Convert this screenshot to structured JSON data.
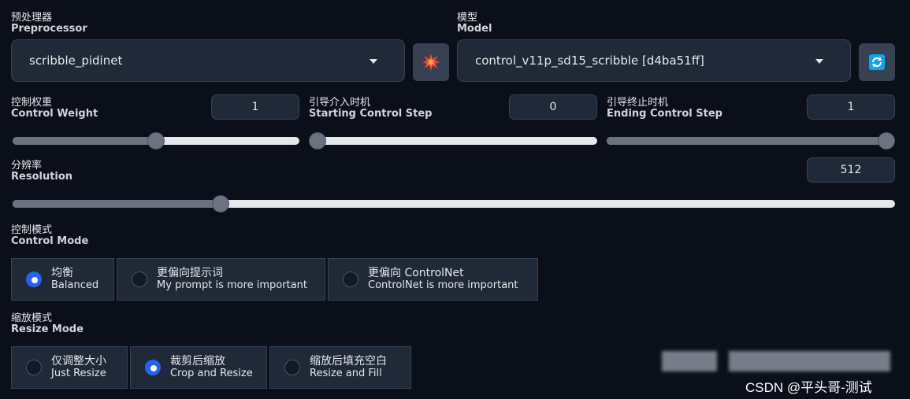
{
  "preprocessor": {
    "label_zh": "预处理器",
    "label_en": "Preprocessor",
    "value": "scribble_pidinet"
  },
  "model": {
    "label_zh": "模型",
    "label_en": "Model",
    "value": "control_v11p_sd15_scribble [d4ba51ff]"
  },
  "icons": {
    "run_preprocessor": "explosion-icon",
    "refresh_models": "refresh-icon"
  },
  "control_weight": {
    "label_zh": "控制权重",
    "label_en": "Control Weight",
    "value": "1",
    "level": 0.5
  },
  "starting_step": {
    "label_zh": "引导介入时机",
    "label_en": "Starting Control Step",
    "value": "0",
    "level": 0.0
  },
  "ending_step": {
    "label_zh": "引导终止时机",
    "label_en": "Ending Control Step",
    "value": "1",
    "level": 1.0
  },
  "resolution": {
    "label_zh": "分辨率",
    "label_en": "Resolution",
    "value": "512",
    "level": 0.23
  },
  "control_mode": {
    "label_zh": "控制模式",
    "label_en": "Control Mode",
    "options": [
      {
        "zh": "均衡",
        "en": "Balanced",
        "selected": true
      },
      {
        "zh": "更偏向提示词",
        "en": "My prompt is more important",
        "selected": false
      },
      {
        "zh": "更偏向 ControlNet",
        "en": "ControlNet is more important",
        "selected": false
      }
    ]
  },
  "resize_mode": {
    "label_zh": "缩放模式",
    "label_en": "Resize Mode",
    "options": [
      {
        "zh": "仅调整大小",
        "en": "Just Resize",
        "selected": false
      },
      {
        "zh": "裁剪后缩放",
        "en": "Crop and Resize",
        "selected": true
      },
      {
        "zh": "缩放后填充空白",
        "en": "Resize and Fill",
        "selected": false
      }
    ]
  },
  "colors": {
    "accent": "#2563eb",
    "background": "#0b0f19",
    "input_bg": "#1f2937"
  },
  "watermark": "CSDN @平头哥-测试"
}
